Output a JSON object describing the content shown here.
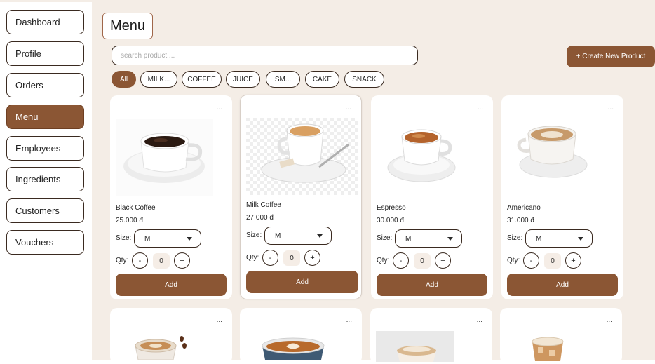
{
  "sidebar": {
    "items": [
      {
        "label": "Dashboard"
      },
      {
        "label": "Profile"
      },
      {
        "label": "Orders"
      },
      {
        "label": "Menu"
      },
      {
        "label": "Employees"
      },
      {
        "label": "Ingredients"
      },
      {
        "label": "Customers"
      },
      {
        "label": "Vouchers"
      }
    ],
    "active": "Menu"
  },
  "page": {
    "title": "Menu",
    "search_placeholder": "search product....",
    "create_label": "+ Create New Product"
  },
  "filters": [
    {
      "label": "All",
      "active": true
    },
    {
      "label": "MILK..."
    },
    {
      "label": "COFFEE"
    },
    {
      "label": "JUICE"
    },
    {
      "label": "SM..."
    },
    {
      "label": "CAKE"
    },
    {
      "label": "SNACK"
    }
  ],
  "card_common": {
    "more": "...",
    "size_label": "Size:",
    "qty_label": "Qty:",
    "minus": "-",
    "plus": "+",
    "add_label": "Add"
  },
  "products": [
    {
      "name": "Black Coffee",
      "price": "25.000 đ",
      "size": "M",
      "qty": "0"
    },
    {
      "name": "Milk Coffee",
      "price": "27.000 đ",
      "size": "M",
      "qty": "0"
    },
    {
      "name": "Espresso",
      "price": "30.000 đ",
      "size": "M",
      "qty": "0"
    },
    {
      "name": "Americano",
      "price": "31.000 đ",
      "size": "M",
      "qty": "0"
    }
  ],
  "colors": {
    "accent": "#8b5634",
    "background": "#f4ede6",
    "border": "#3a2a20"
  },
  "icons": [
    "more-icon",
    "caret-down-icon",
    "minus-icon",
    "plus-icon"
  ]
}
